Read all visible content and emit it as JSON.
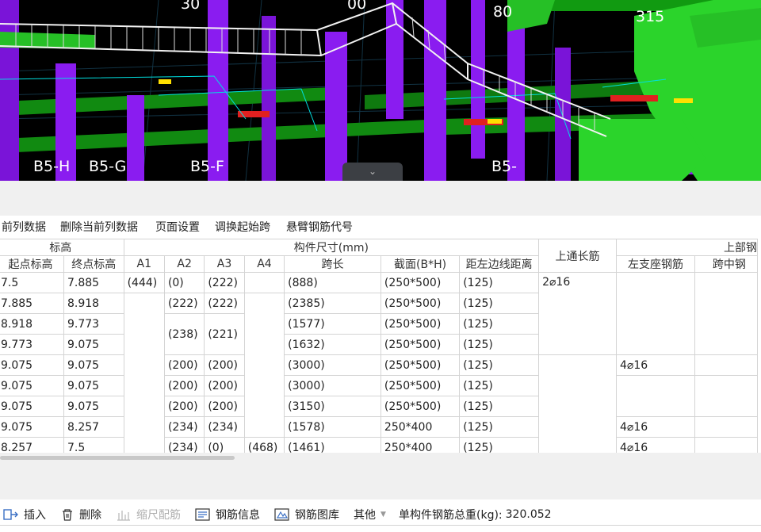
{
  "viewport": {
    "labels": [
      "B5-H",
      "B5-G",
      "B5-F",
      "B5-",
      "80",
      "315",
      "30",
      "00"
    ]
  },
  "toolbar_top": {
    "items": [
      "前列数据",
      "删除当前列数据",
      "页面设置",
      "调换起始跨",
      "悬臂钢筋代号"
    ]
  },
  "grid": {
    "header_group": {
      "elevation": "标高",
      "dimensions": "构件尺寸(mm)",
      "top_through": "上通长筋",
      "top_rebar": "上部钢"
    },
    "headers": {
      "start_elev": "起点标高",
      "end_elev": "终点标高",
      "a1": "A1",
      "a2": "A2",
      "a3": "A3",
      "a4": "A4",
      "span": "跨长",
      "section": "截面(B*H)",
      "left_edge": "距左边线距离",
      "left_support": "左支座钢筋",
      "mid_span": "跨中钢"
    },
    "rows": [
      {
        "start": "7.5",
        "end": "7.885",
        "a1": "(444)",
        "a2": "(0)",
        "a3": "(222)",
        "a4": "",
        "span": "(888)",
        "section": "(250*500)",
        "edge": "(125)",
        "through": "2⌀16",
        "left": ""
      },
      {
        "start": "7.885",
        "end": "8.918",
        "a1": "",
        "a2": "(222)",
        "a3": "(222)",
        "a4": "",
        "span": "(2385)",
        "section": "(250*500)",
        "edge": "(125)",
        "through": "",
        "left": ""
      },
      {
        "start": "8.918",
        "end": "9.773",
        "a1": "",
        "a2": "(238)",
        "a3": "(221)",
        "a4": "",
        "span": "(1577)",
        "section": "(250*500)",
        "edge": "(125)",
        "through": "",
        "left": ""
      },
      {
        "start": "9.773",
        "end": "9.075",
        "a1": "",
        "a2": "",
        "a3": "",
        "a4": "",
        "span": "(1632)",
        "section": "(250*500)",
        "edge": "(125)",
        "through": "",
        "left": ""
      },
      {
        "start": "9.075",
        "end": "9.075",
        "a1": "",
        "a2": "(200)",
        "a3": "(200)",
        "a4": "",
        "span": "(3000)",
        "section": "(250*500)",
        "edge": "(125)",
        "through": "",
        "left": "4⌀16"
      },
      {
        "start": "9.075",
        "end": "9.075",
        "a1": "",
        "a2": "(200)",
        "a3": "(200)",
        "a4": "",
        "span": "(3000)",
        "section": "(250*500)",
        "edge": "(125)",
        "through": "",
        "left": ""
      },
      {
        "start": "9.075",
        "end": "9.075",
        "a1": "",
        "a2": "(200)",
        "a3": "(200)",
        "a4": "",
        "span": "(3150)",
        "section": "(250*500)",
        "edge": "(125)",
        "through": "",
        "left": ""
      },
      {
        "start": "9.075",
        "end": "8.257",
        "a1": "",
        "a2": "(234)",
        "a3": "(234)",
        "a4": "",
        "span": "(1578)",
        "section": "250*400",
        "edge": "(125)",
        "through": "",
        "left": "4⌀16"
      },
      {
        "start": "8.257",
        "end": "7.5",
        "a1": "",
        "a2": "(234)",
        "a3": "(0)",
        "a4": "(468)",
        "span": "(1461)",
        "section": "250*400",
        "edge": "(125)",
        "through": "",
        "left": "4⌀16"
      }
    ]
  },
  "toolbar_bottom": {
    "insert": "插入",
    "delete": "删除",
    "scale": "缩尺配筋",
    "info": "钢筋信息",
    "library": "钢筋图库",
    "other": "其他",
    "total_label": "单构件钢筋总重(kg):",
    "total_value": "320.052"
  },
  "colors": {
    "purple": "#8a1cf0",
    "green": "#1aa81a",
    "bright_green": "#2bd42b",
    "cyan": "#00e0e0",
    "red": "#e02020",
    "yellow": "#ffe000"
  }
}
